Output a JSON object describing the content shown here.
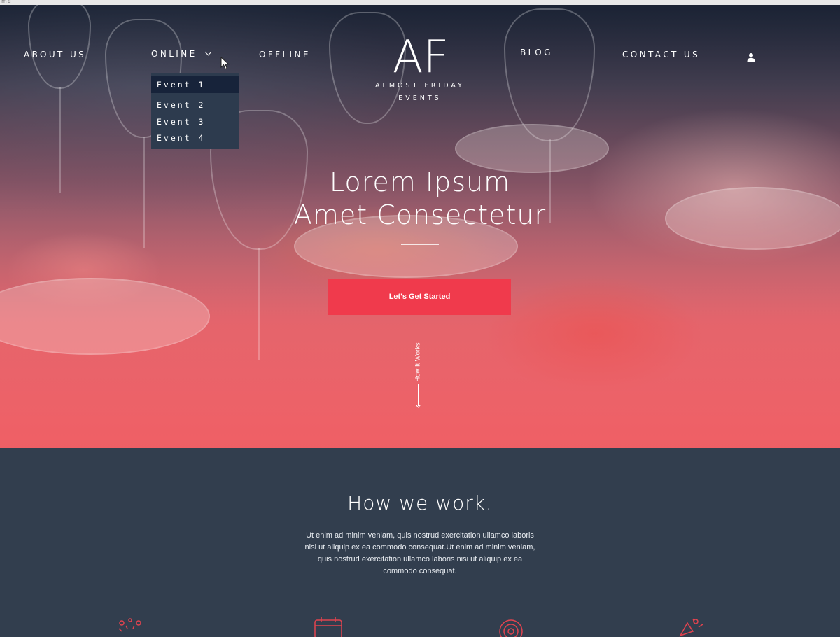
{
  "browser": {
    "tab_text": "me"
  },
  "nav": {
    "about": "About us",
    "online": "Online",
    "offline": "Offline",
    "blog": "Blog",
    "contact": "Contact us"
  },
  "brand": {
    "monogram": "AF",
    "line1": "Almost Friday",
    "line2": "Events"
  },
  "dropdown": {
    "items": [
      "Event 1",
      "Event 2",
      "Event 3",
      "Event 4"
    ],
    "active_index": 0
  },
  "hero": {
    "title_line1": "Lorem Ipsum",
    "title_line2": "Amet Consectetur",
    "cta_label": "Let's Get Started",
    "scroll_label": "How It Works"
  },
  "section": {
    "title": "How we work.",
    "body": "Ut enim ad minim veniam, quis nostrud exercitation ullamco laboris nisi ut aliquip ex ea commodo consequat.Ut enim ad minim veniam, quis nostrud exercitation ullamco laboris nisi ut aliquip ex ea commodo consequat."
  },
  "feature_icons": [
    "celebration-icon",
    "calendar-icon",
    "target-icon",
    "party-icon"
  ],
  "colors": {
    "accent": "#f03a4c",
    "section_bg": "#323e4e",
    "dropdown_bg": "#2d3b4e",
    "dropdown_active": "#17233a",
    "icon_red": "#e2434f"
  }
}
